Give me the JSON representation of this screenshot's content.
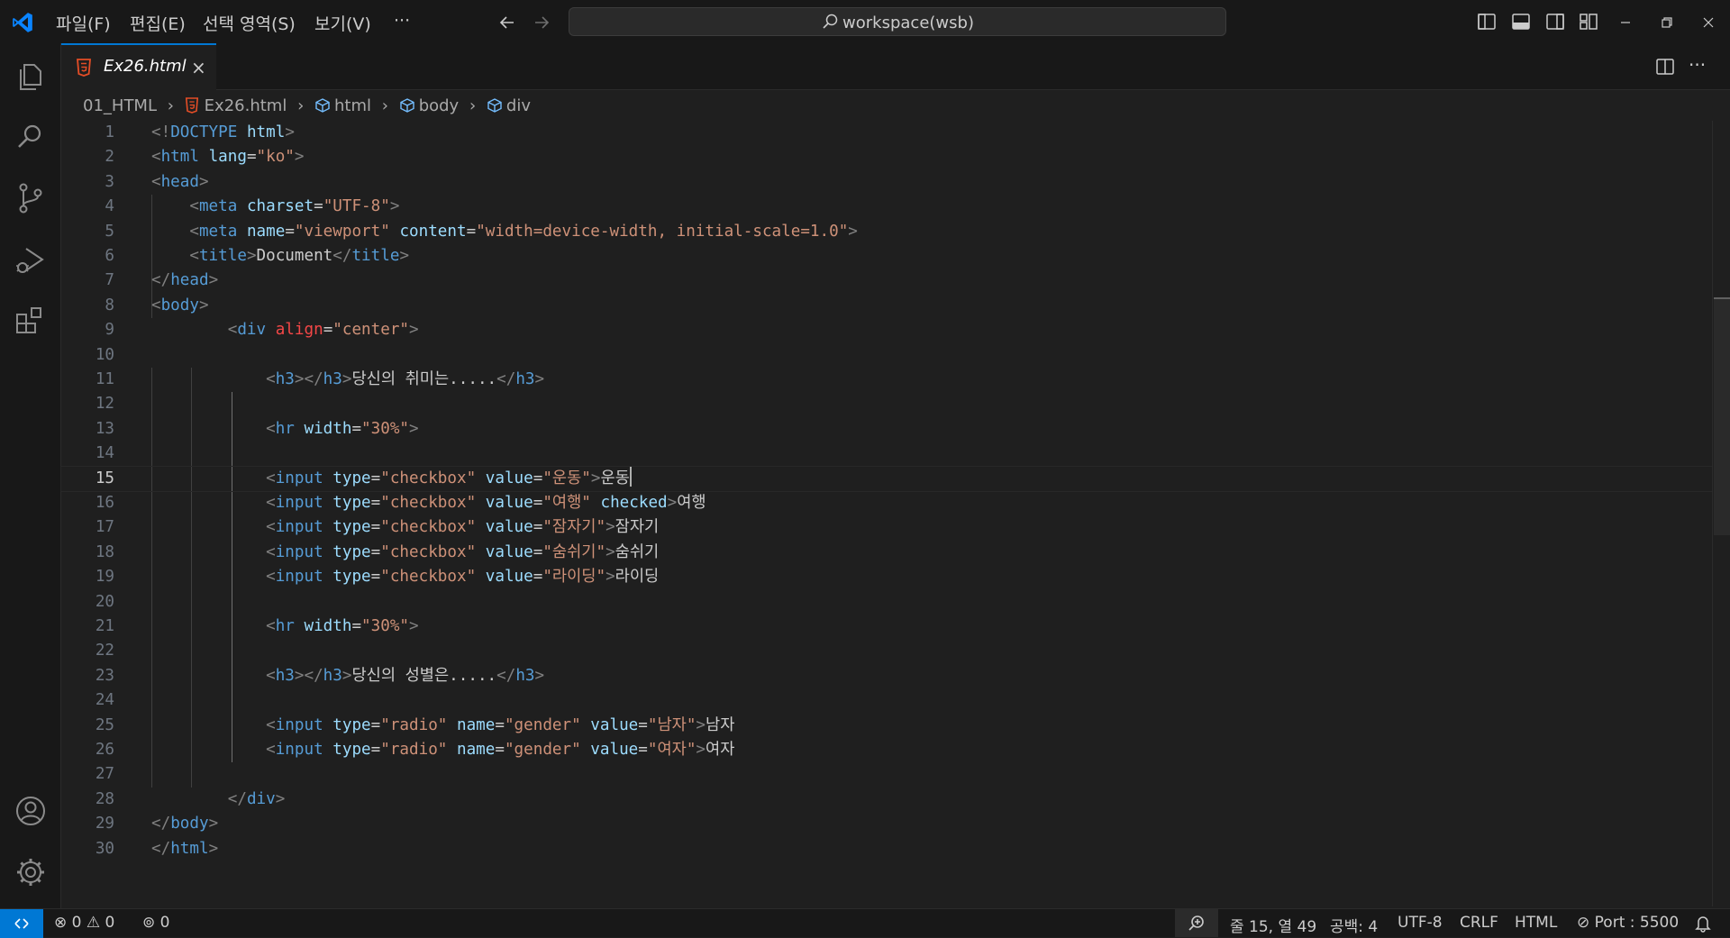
{
  "menu": [
    "파일(F)",
    "편집(E)",
    "선택 영역(S)",
    "보기(V)",
    "···"
  ],
  "search": {
    "text": "workspace(wsb)"
  },
  "tab": {
    "label": "Ex26.html",
    "close": "×"
  },
  "breadcrumb": [
    "01_HTML",
    "Ex26.html",
    "html",
    "body",
    "div"
  ],
  "editor": {
    "current_line": 15,
    "lines": [
      {
        "n": "1",
        "tokens": [
          [
            "br",
            "<!"
          ],
          [
            "tag",
            "DOCTYPE "
          ],
          [
            "attr",
            "html"
          ],
          [
            "br",
            ">"
          ]
        ]
      },
      {
        "n": "2",
        "tokens": [
          [
            "br",
            "<"
          ],
          [
            "tag",
            "html "
          ],
          [
            "attr",
            "lang"
          ],
          [
            "txt",
            "="
          ],
          [
            "str",
            "\"ko\""
          ],
          [
            "br",
            ">"
          ]
        ]
      },
      {
        "n": "3",
        "tokens": [
          [
            "br",
            "<"
          ],
          [
            "tag",
            "head"
          ],
          [
            "br",
            ">"
          ]
        ]
      },
      {
        "n": "4",
        "tokens": [
          [
            "txt",
            "    "
          ],
          [
            "br",
            "<"
          ],
          [
            "tag",
            "meta "
          ],
          [
            "attr",
            "charset"
          ],
          [
            "txt",
            "="
          ],
          [
            "str",
            "\"UTF-8\""
          ],
          [
            "br",
            ">"
          ]
        ]
      },
      {
        "n": "5",
        "tokens": [
          [
            "txt",
            "    "
          ],
          [
            "br",
            "<"
          ],
          [
            "tag",
            "meta "
          ],
          [
            "attr",
            "name"
          ],
          [
            "txt",
            "="
          ],
          [
            "str",
            "\"viewport\" "
          ],
          [
            "attr",
            "content"
          ],
          [
            "txt",
            "="
          ],
          [
            "str",
            "\"width=device-width, initial-scale=1.0\""
          ],
          [
            "br",
            ">"
          ]
        ]
      },
      {
        "n": "6",
        "tokens": [
          [
            "txt",
            "    "
          ],
          [
            "br",
            "<"
          ],
          [
            "tag",
            "title"
          ],
          [
            "br",
            ">"
          ],
          [
            "txt",
            "Document"
          ],
          [
            "br",
            "</"
          ],
          [
            "tag",
            "title"
          ],
          [
            "br",
            ">"
          ]
        ]
      },
      {
        "n": "7",
        "tokens": [
          [
            "br",
            "</"
          ],
          [
            "tag",
            "head"
          ],
          [
            "br",
            ">"
          ]
        ]
      },
      {
        "n": "8",
        "tokens": [
          [
            "br",
            "<"
          ],
          [
            "tag",
            "body"
          ],
          [
            "br",
            ">"
          ]
        ]
      },
      {
        "n": "9",
        "tokens": [
          [
            "txt",
            "        "
          ],
          [
            "br",
            "<"
          ],
          [
            "tag",
            "div "
          ],
          [
            "bad",
            "align"
          ],
          [
            "txt",
            "="
          ],
          [
            "str",
            "\"center\""
          ],
          [
            "br",
            ">"
          ]
        ]
      },
      {
        "n": "10",
        "tokens": []
      },
      {
        "n": "11",
        "tokens": [
          [
            "txt",
            "            "
          ],
          [
            "br",
            "<"
          ],
          [
            "tag",
            "h3"
          ],
          [
            "br",
            "></"
          ],
          [
            "tag",
            "h3"
          ],
          [
            "br",
            ">"
          ],
          [
            "txt",
            "당신의 취미는....."
          ],
          [
            "br",
            "</"
          ],
          [
            "tag",
            "h3"
          ],
          [
            "br",
            ">"
          ]
        ]
      },
      {
        "n": "12",
        "tokens": []
      },
      {
        "n": "13",
        "tokens": [
          [
            "txt",
            "            "
          ],
          [
            "br",
            "<"
          ],
          [
            "tag",
            "hr "
          ],
          [
            "attr",
            "width"
          ],
          [
            "txt",
            "="
          ],
          [
            "str",
            "\"30%\""
          ],
          [
            "br",
            ">"
          ]
        ]
      },
      {
        "n": "14",
        "tokens": []
      },
      {
        "n": "15",
        "tokens": [
          [
            "txt",
            "            "
          ],
          [
            "br",
            "<"
          ],
          [
            "tag",
            "input "
          ],
          [
            "attr",
            "type"
          ],
          [
            "txt",
            "="
          ],
          [
            "str",
            "\"checkbox\" "
          ],
          [
            "attr",
            "value"
          ],
          [
            "txt",
            "="
          ],
          [
            "str",
            "\"운동\""
          ],
          [
            "br",
            ">"
          ],
          [
            "txt",
            "운동"
          ],
          [
            "cursor",
            ""
          ]
        ]
      },
      {
        "n": "16",
        "tokens": [
          [
            "txt",
            "            "
          ],
          [
            "br",
            "<"
          ],
          [
            "tag",
            "input "
          ],
          [
            "attr",
            "type"
          ],
          [
            "txt",
            "="
          ],
          [
            "str",
            "\"checkbox\" "
          ],
          [
            "attr",
            "value"
          ],
          [
            "txt",
            "="
          ],
          [
            "str",
            "\"여행\" "
          ],
          [
            "attr",
            "checked"
          ],
          [
            "br",
            ">"
          ],
          [
            "txt",
            "여행"
          ]
        ]
      },
      {
        "n": "17",
        "tokens": [
          [
            "txt",
            "            "
          ],
          [
            "br",
            "<"
          ],
          [
            "tag",
            "input "
          ],
          [
            "attr",
            "type"
          ],
          [
            "txt",
            "="
          ],
          [
            "str",
            "\"checkbox\" "
          ],
          [
            "attr",
            "value"
          ],
          [
            "txt",
            "="
          ],
          [
            "str",
            "\"잠자기\""
          ],
          [
            "br",
            ">"
          ],
          [
            "txt",
            "잠자기"
          ]
        ]
      },
      {
        "n": "18",
        "tokens": [
          [
            "txt",
            "            "
          ],
          [
            "br",
            "<"
          ],
          [
            "tag",
            "input "
          ],
          [
            "attr",
            "type"
          ],
          [
            "txt",
            "="
          ],
          [
            "str",
            "\"checkbox\" "
          ],
          [
            "attr",
            "value"
          ],
          [
            "txt",
            "="
          ],
          [
            "str",
            "\"숨쉬기\""
          ],
          [
            "br",
            ">"
          ],
          [
            "txt",
            "숨쉬기"
          ]
        ]
      },
      {
        "n": "19",
        "tokens": [
          [
            "txt",
            "            "
          ],
          [
            "br",
            "<"
          ],
          [
            "tag",
            "input "
          ],
          [
            "attr",
            "type"
          ],
          [
            "txt",
            "="
          ],
          [
            "str",
            "\"checkbox\" "
          ],
          [
            "attr",
            "value"
          ],
          [
            "txt",
            "="
          ],
          [
            "str",
            "\"라이딩\""
          ],
          [
            "br",
            ">"
          ],
          [
            "txt",
            "라이딩"
          ]
        ]
      },
      {
        "n": "20",
        "tokens": []
      },
      {
        "n": "21",
        "tokens": [
          [
            "txt",
            "            "
          ],
          [
            "br",
            "<"
          ],
          [
            "tag",
            "hr "
          ],
          [
            "attr",
            "width"
          ],
          [
            "txt",
            "="
          ],
          [
            "str",
            "\"30%\""
          ],
          [
            "br",
            ">"
          ]
        ]
      },
      {
        "n": "22",
        "tokens": []
      },
      {
        "n": "23",
        "tokens": [
          [
            "txt",
            "            "
          ],
          [
            "br",
            "<"
          ],
          [
            "tag",
            "h3"
          ],
          [
            "br",
            "></"
          ],
          [
            "tag",
            "h3"
          ],
          [
            "br",
            ">"
          ],
          [
            "txt",
            "당신의 성별은....."
          ],
          [
            "br",
            "</"
          ],
          [
            "tag",
            "h3"
          ],
          [
            "br",
            ">"
          ]
        ]
      },
      {
        "n": "24",
        "tokens": []
      },
      {
        "n": "25",
        "tokens": [
          [
            "txt",
            "            "
          ],
          [
            "br",
            "<"
          ],
          [
            "tag",
            "input "
          ],
          [
            "attr",
            "type"
          ],
          [
            "txt",
            "="
          ],
          [
            "str",
            "\"radio\" "
          ],
          [
            "attr",
            "name"
          ],
          [
            "txt",
            "="
          ],
          [
            "str",
            "\"gender\" "
          ],
          [
            "attr",
            "value"
          ],
          [
            "txt",
            "="
          ],
          [
            "str",
            "\"남자\""
          ],
          [
            "br",
            ">"
          ],
          [
            "txt",
            "남자"
          ]
        ]
      },
      {
        "n": "26",
        "tokens": [
          [
            "txt",
            "            "
          ],
          [
            "br",
            "<"
          ],
          [
            "tag",
            "input "
          ],
          [
            "attr",
            "type"
          ],
          [
            "txt",
            "="
          ],
          [
            "str",
            "\"radio\" "
          ],
          [
            "attr",
            "name"
          ],
          [
            "txt",
            "="
          ],
          [
            "str",
            "\"gender\" "
          ],
          [
            "attr",
            "value"
          ],
          [
            "txt",
            "="
          ],
          [
            "str",
            "\"여자\""
          ],
          [
            "br",
            ">"
          ],
          [
            "txt",
            "여자"
          ]
        ]
      },
      {
        "n": "27",
        "tokens": []
      },
      {
        "n": "28",
        "tokens": [
          [
            "txt",
            "        "
          ],
          [
            "br",
            "</"
          ],
          [
            "tag",
            "div"
          ],
          [
            "br",
            ">"
          ]
        ]
      },
      {
        "n": "29",
        "tokens": [
          [
            "br",
            "</"
          ],
          [
            "tag",
            "body"
          ],
          [
            "br",
            ">"
          ]
        ]
      },
      {
        "n": "30",
        "tokens": [
          [
            "br",
            "</"
          ],
          [
            "tag",
            "html"
          ],
          [
            "br",
            ">"
          ]
        ]
      }
    ]
  },
  "status": {
    "errors": "0",
    "warnings": "0",
    "ports": "0",
    "position": "줄 15, 열 49",
    "spaces": "공백: 4",
    "encoding": "UTF-8",
    "eol": "CRLF",
    "language": "HTML",
    "port": "Port : 5500"
  },
  "colors": {
    "accent": "#0078d4",
    "html_icon": "#e44d26"
  }
}
